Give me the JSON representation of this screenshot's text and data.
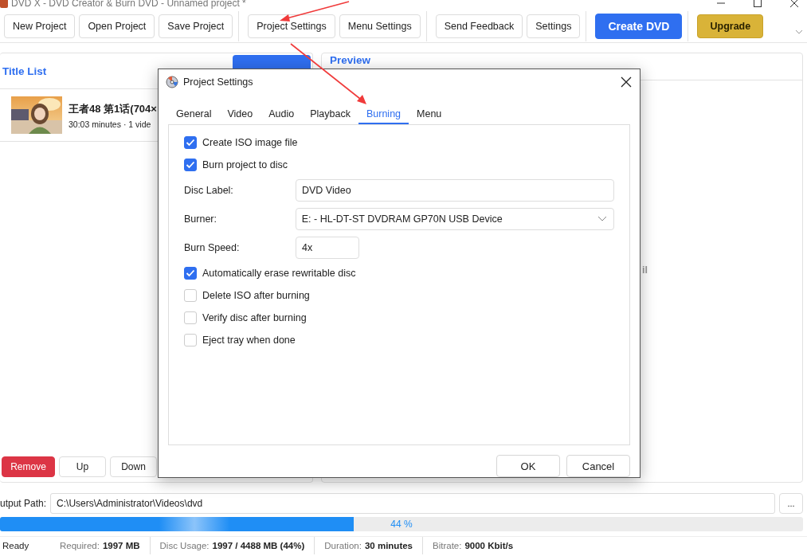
{
  "window": {
    "title": "DVD X - DVD Creator & Burn DVD - Unnamed project *"
  },
  "toolbar": {
    "groups": [
      [
        {
          "label": "New Project",
          "kind": "plain"
        },
        {
          "label": "Open Project",
          "kind": "plain"
        },
        {
          "label": "Save Project",
          "kind": "plain"
        }
      ],
      [
        {
          "label": "Project Settings",
          "kind": "plain"
        },
        {
          "label": "Menu Settings",
          "kind": "plain"
        }
      ],
      [
        {
          "label": "Send Feedback",
          "kind": "plain"
        },
        {
          "label": "Settings",
          "kind": "plain"
        }
      ],
      [
        {
          "label": "Create DVD",
          "kind": "primary"
        }
      ],
      [
        {
          "label": "Upgrade",
          "kind": "upgrade"
        }
      ]
    ]
  },
  "title_list": {
    "title": "Title List",
    "items": [
      {
        "title": "王者48 第1话(704×",
        "subtitle": "30:03 minutes · 1 vide"
      }
    ],
    "buttons": [
      {
        "label": "Remove",
        "kind": "danger"
      },
      {
        "label": "Up",
        "kind": "plain"
      },
      {
        "label": "Down",
        "kind": "plain"
      }
    ]
  },
  "preview": {
    "title": "Preview",
    "fragment": "il"
  },
  "output": {
    "label": "utput Path:",
    "value": "C:\\Users\\Administrator\\Videos\\dvd",
    "browse": "..."
  },
  "progress": {
    "level": 0.44,
    "label": "44 %"
  },
  "status_bar": {
    "state": "Ready",
    "items": [
      {
        "label": "Required:",
        "value": "1997 MB"
      },
      {
        "label": "Disc Usage:",
        "value": "1997 / 4488 MB (44%)"
      },
      {
        "label": "Duration:",
        "value": "30 minutes"
      },
      {
        "label": "Bitrate:",
        "value": "9000 Kbit/s"
      }
    ]
  },
  "dialog": {
    "title": "Project Settings",
    "tabs": [
      {
        "label": "General",
        "selected": false
      },
      {
        "label": "Video",
        "selected": false
      },
      {
        "label": "Audio",
        "selected": false
      },
      {
        "label": "Playback",
        "selected": false
      },
      {
        "label": "Burning",
        "selected": true
      },
      {
        "label": "Menu",
        "selected": false
      }
    ],
    "options": [
      {
        "kind": "checkbox",
        "label": "Create ISO image file",
        "checked": true
      },
      {
        "kind": "checkbox",
        "label": "Burn project to disc",
        "checked": true
      },
      {
        "kind": "text",
        "label": "Disc Label:",
        "value": "DVD Video"
      },
      {
        "kind": "select",
        "label": "Burner:",
        "value": "E: - HL-DT-ST DVDRAM GP70N USB Device"
      },
      {
        "kind": "short_text",
        "label": "Burn Speed:",
        "value": "4x"
      },
      {
        "kind": "checkbox",
        "label": "Automatically erase rewritable disc",
        "checked": true
      },
      {
        "kind": "checkbox",
        "label": "Delete ISO after burning",
        "checked": false
      },
      {
        "kind": "checkbox",
        "label": "Verify disc after burning",
        "checked": false
      },
      {
        "kind": "checkbox",
        "label": "Eject tray when done",
        "checked": false
      }
    ],
    "buttons": [
      "OK",
      "Cancel"
    ]
  }
}
